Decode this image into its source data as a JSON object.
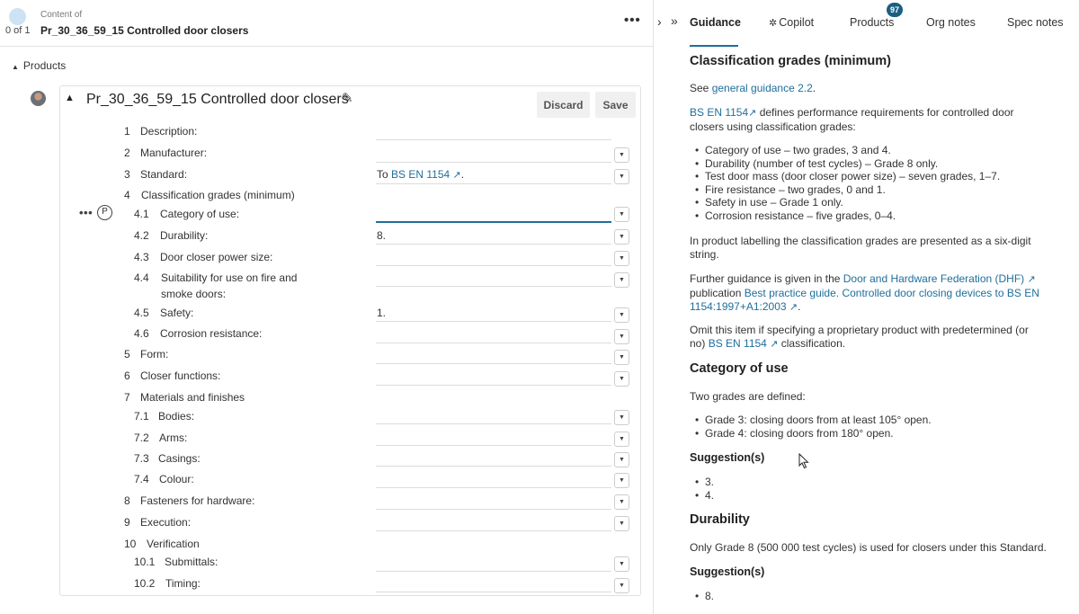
{
  "header": {
    "count": "0 of 1",
    "content_of": "Content of",
    "title": "Pr_30_36_59_15 Controlled door closers",
    "more": "•••"
  },
  "tabs": {
    "nav_prev": "›",
    "nav_expand": "»",
    "items": [
      {
        "label": "Guidance"
      },
      {
        "label": "Copilot",
        "icon": "✲"
      },
      {
        "label": "Products",
        "badge": "97"
      },
      {
        "label": "Org notes"
      },
      {
        "label": "Spec notes"
      }
    ]
  },
  "products": {
    "toggle_label": "Products",
    "card": {
      "title": "Pr_30_36_59_15 Controlled door closers",
      "discard_label": "Discard",
      "save_label": "Save",
      "more": "•••",
      "p_icon": "P",
      "rows": [
        {
          "num": "1",
          "label": "Description:",
          "value": ""
        },
        {
          "num": "2",
          "label": "Manufacturer:",
          "value": ""
        },
        {
          "num": "3",
          "label": "Standard:",
          "value_prefix": "To ",
          "value_link": "BS EN 1154",
          "value_suffix": "."
        },
        {
          "num": "4",
          "label": "Classification grades (minimum)"
        },
        {
          "num": "4.1",
          "label": "Category of use:",
          "value": ""
        },
        {
          "num": "4.2",
          "label": "Durability:",
          "value": "8."
        },
        {
          "num": "4.3",
          "label": "Door closer power size:",
          "value": ""
        },
        {
          "num": "4.4",
          "label": "Suitability for use on fire and",
          "label2": "smoke doors:",
          "value": ""
        },
        {
          "num": "4.5",
          "label": "Safety:",
          "value": "1."
        },
        {
          "num": "4.6",
          "label": "Corrosion resistance:",
          "value": ""
        },
        {
          "num": "5",
          "label": "Form:",
          "value": ""
        },
        {
          "num": "6",
          "label": "Closer functions:",
          "value": ""
        },
        {
          "num": "7",
          "label": "Materials and finishes"
        },
        {
          "num": "7.1",
          "label": "Bodies:",
          "value": ""
        },
        {
          "num": "7.2",
          "label": "Arms:",
          "value": ""
        },
        {
          "num": "7.3",
          "label": "Casings:",
          "value": ""
        },
        {
          "num": "7.4",
          "label": "Colour:",
          "value": ""
        },
        {
          "num": "8",
          "label": "Fasteners for hardware:",
          "value": ""
        },
        {
          "num": "9",
          "label": "Execution:",
          "value": ""
        },
        {
          "num": "10",
          "label": "Verification"
        },
        {
          "num": "10.1",
          "label": "Submittals:",
          "value": ""
        },
        {
          "num": "10.2",
          "label": "Timing:",
          "value": ""
        }
      ]
    }
  },
  "guidance": {
    "h_class": "Classification grades (minimum)",
    "see_prefix": "See ",
    "see_link": "general guidance 2.2",
    "see_suffix": ".",
    "std_link": "BS EN 1154",
    "std_text1": " defines performance requirements for controlled door",
    "std_text2": "closers using classification grades:",
    "class_items": [
      "Category of use – two grades, 3 and 4.",
      "Durability (number of test cycles) – Grade 8 only.",
      "Test door mass (door closer power size) – seven grades, 1–7.",
      "Fire resistance – two grades, 0 and 1.",
      "Safety in use – Grade 1 only.",
      "Corrosion resistance – five grades, 0–4."
    ],
    "label_text1": "In product labelling the classification grades are presented as a six-digit",
    "label_text2": "string.",
    "further_prefix": "Further guidance is given in the ",
    "further_link1": "Door and Hardware Federation (DHF)",
    "further_mid": "publication ",
    "further_link2a": "Best practice guide. Controlled door closing devices to BS EN",
    "further_link2b": "1154:1997+A1:2003",
    "further_suffix": ".",
    "omit_text1": "Omit this item if specifying a proprietary product with predetermined (or",
    "omit_prefix2": "no) ",
    "omit_link": "BS EN 1154",
    "omit_suffix": " classification.",
    "h_cat": "Category of use",
    "cat_intro": "Two grades are defined:",
    "cat_items": [
      "Grade 3: closing doors from at least 105° open.",
      "Grade 4: closing doors from 180° open."
    ],
    "h_sugg1": "Suggestion(s)",
    "sugg1_items": [
      "3.",
      "4."
    ],
    "h_dur": "Durability",
    "dur_text": "Only Grade 8 (500 000 test cycles) is used for closers under this Standard.",
    "h_sugg2": "Suggestion(s)",
    "sugg2_items": [
      "8."
    ],
    "ext_icon": "↗"
  },
  "colors": {
    "link": "#1f6f9b",
    "badge": "#1a5f83",
    "active_underline": "#1f6f9b"
  }
}
